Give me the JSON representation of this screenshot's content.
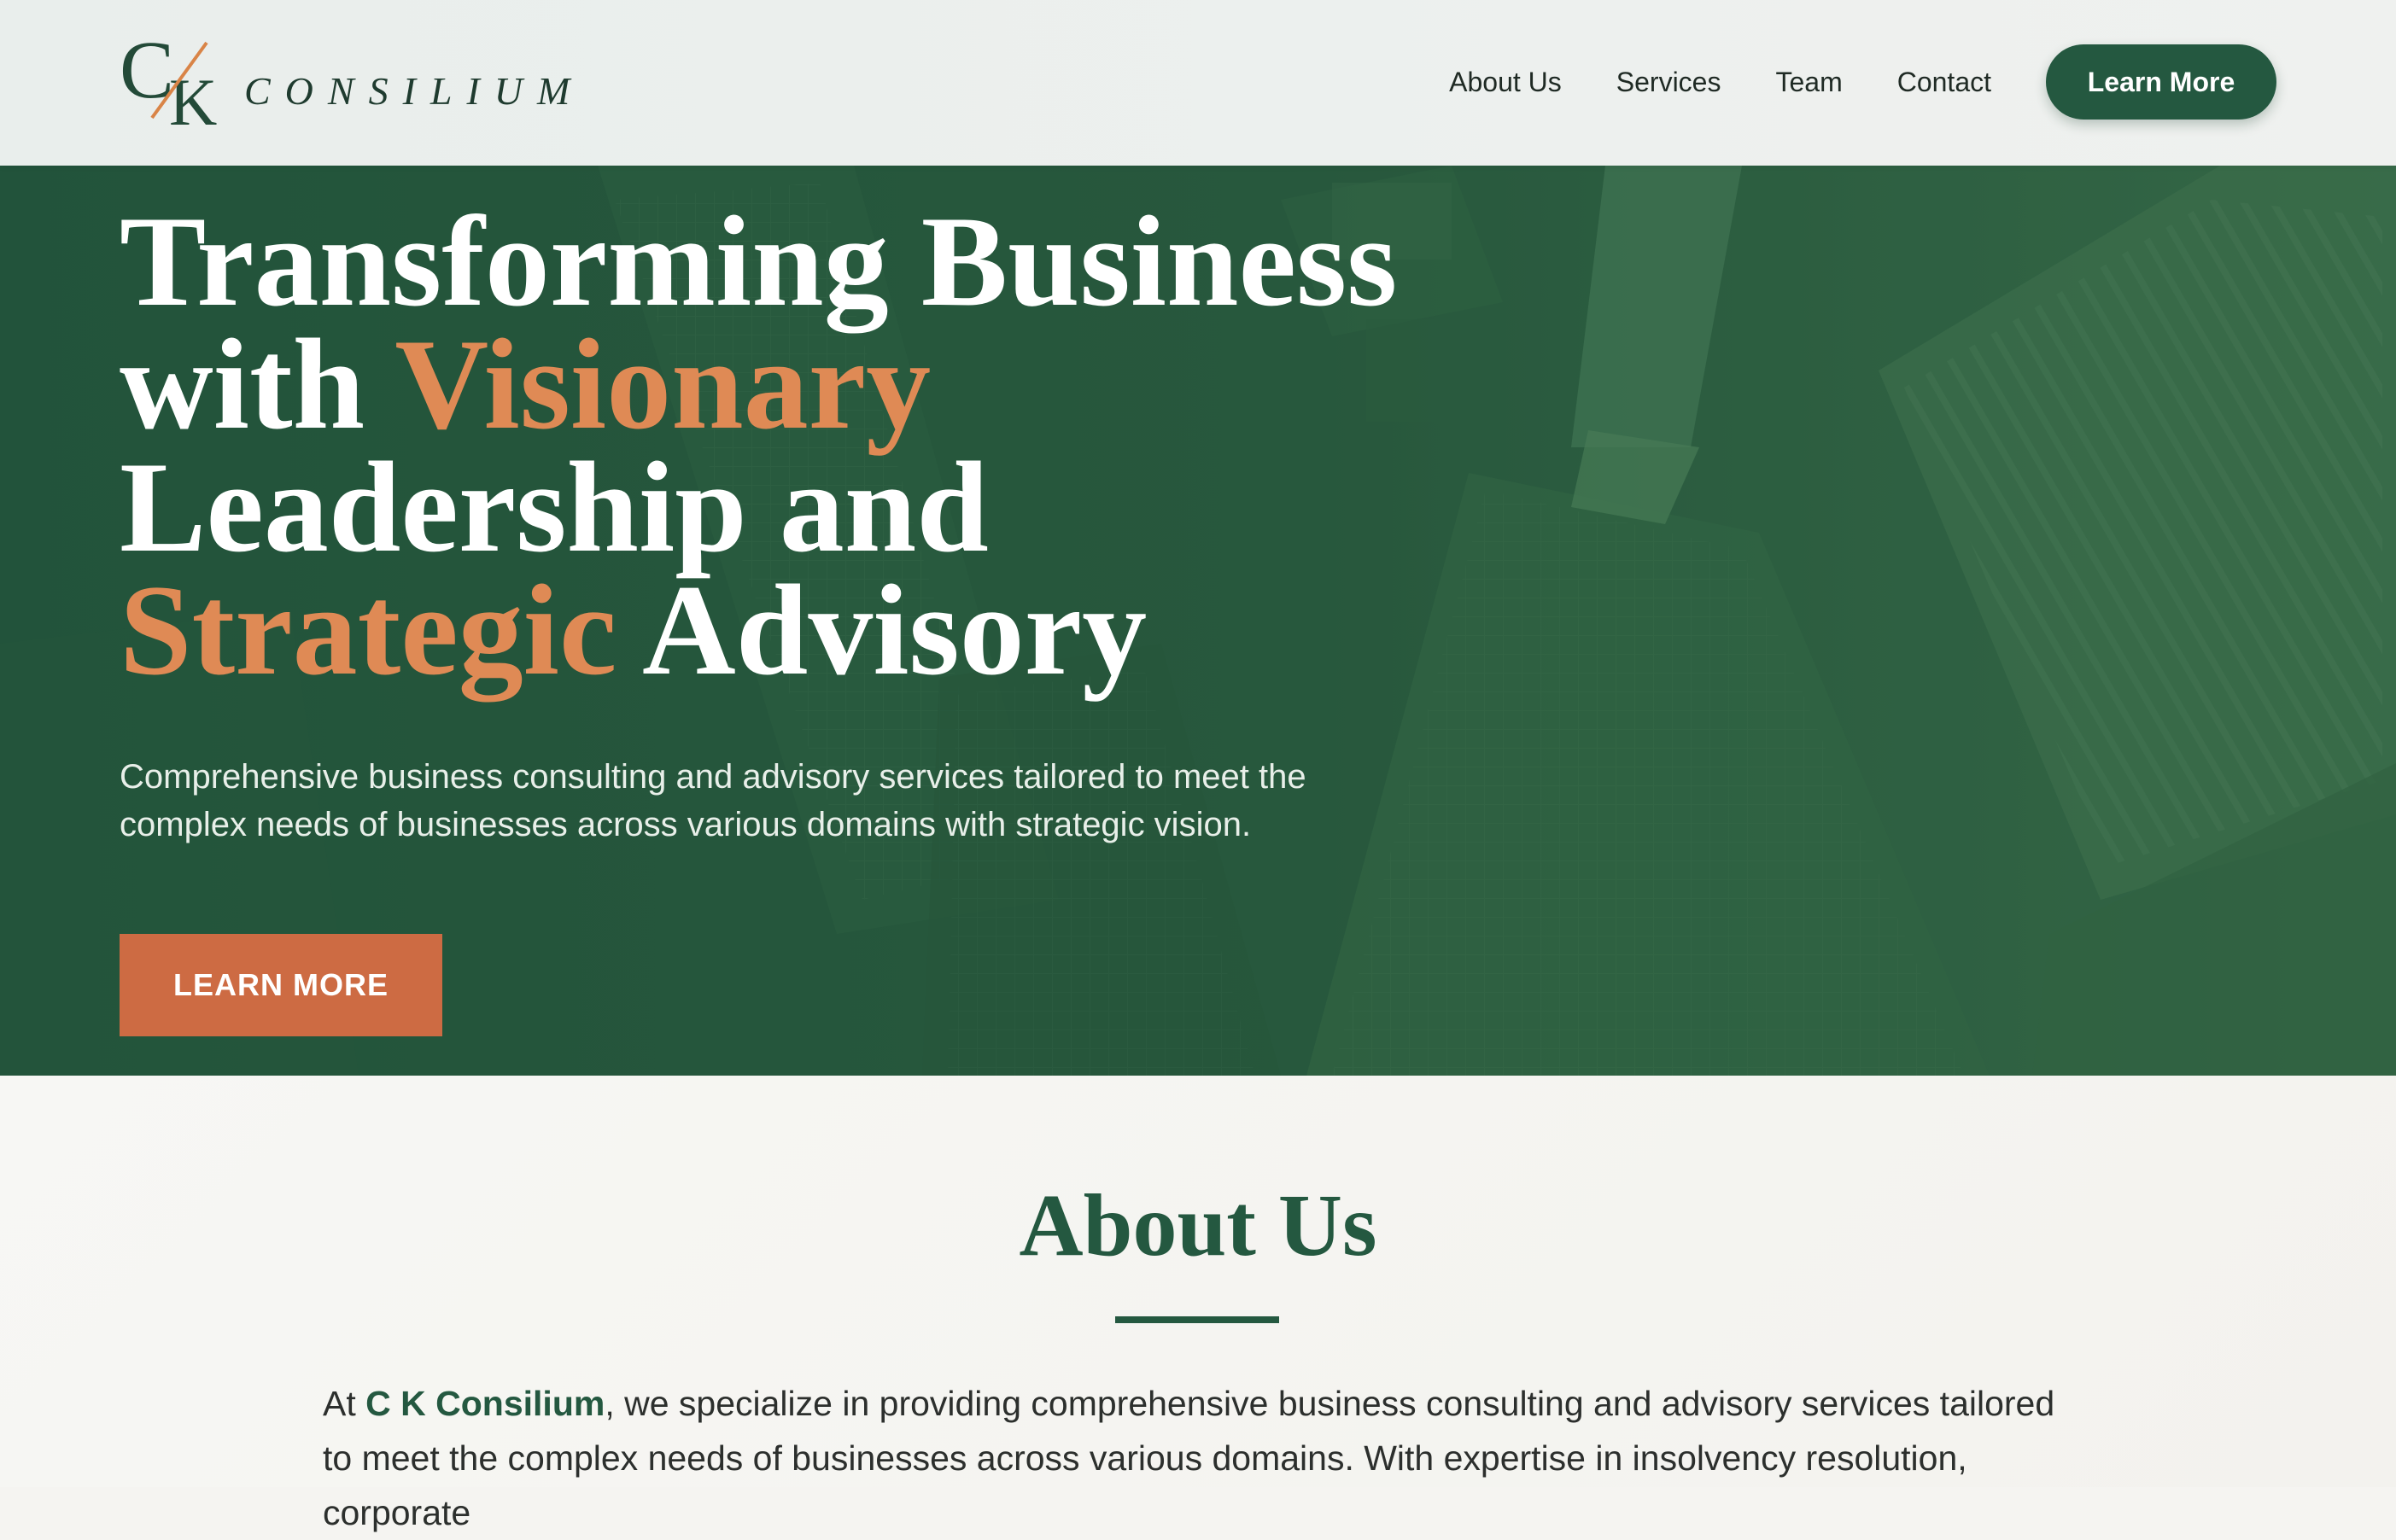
{
  "header": {
    "logo": {
      "monogram_c": "C",
      "monogram_k": "K",
      "wordmark": "CONSILIUM"
    },
    "nav": [
      {
        "label": "About Us"
      },
      {
        "label": "Services"
      },
      {
        "label": "Team"
      },
      {
        "label": "Contact"
      }
    ],
    "cta_label": "Learn More"
  },
  "hero": {
    "title": {
      "line1": "Transforming Business",
      "line2_a": "with ",
      "line2_accent": "Visionary",
      "line3": "Leadership and",
      "line4_accent": "Strategic",
      "line4_b": " Advisory"
    },
    "subtitle": "Comprehensive business consulting and advisory services tailored to meet the complex needs of businesses across various domains with strategic vision.",
    "button_label": "LEARN MORE"
  },
  "about": {
    "title": "About Us",
    "text_prefix": "At ",
    "text_brand": "C K Consilium",
    "text_body": ", we specialize in providing comprehensive business consulting and advisory services tailored to meet the complex needs of businesses across various domains. With expertise in insolvency resolution, corporate"
  },
  "colors": {
    "brand_green": "#245840",
    "accent_orange": "#cd6b43",
    "accent_text": "#df8a55",
    "hero_overlay": "#2a5a40"
  }
}
